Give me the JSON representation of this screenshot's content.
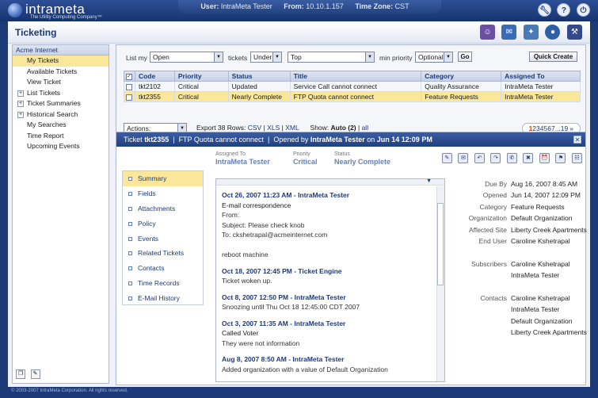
{
  "brand": {
    "name": "intrameta",
    "tagline": "The Utility Computing Company™"
  },
  "session": {
    "user_label": "User:",
    "user": "IntraMeta Tester",
    "from_label": "From:",
    "from": "10.10.1.157",
    "tz_label": "Time Zone:",
    "tz": "CST"
  },
  "top_icons": [
    "wrench-icon",
    "help-icon",
    "power-icon"
  ],
  "page_title": "Ticketing",
  "module_icons": [
    "users-icon",
    "ticket-icon",
    "network-icon",
    "globe-icon",
    "tools-icon"
  ],
  "sidebar": {
    "org": "Acme Internet",
    "items": [
      {
        "label": "My Tickets",
        "selected": true,
        "expandable": false
      },
      {
        "label": "Available Tickets",
        "selected": false,
        "expandable": false
      },
      {
        "label": "View Ticket",
        "selected": false,
        "expandable": false
      },
      {
        "label": "List Tickets",
        "selected": false,
        "expandable": true
      },
      {
        "label": "Ticket Summaries",
        "selected": false,
        "expandable": true
      },
      {
        "label": "Historical Search",
        "selected": false,
        "expandable": true
      },
      {
        "label": "My Searches",
        "selected": false,
        "expandable": false
      },
      {
        "label": "Time Report",
        "selected": false,
        "expandable": false
      },
      {
        "label": "Upcoming Events",
        "selected": false,
        "expandable": false
      }
    ]
  },
  "filters": {
    "list_my_label": "List my",
    "list_my_value": "Open",
    "tickets_label": "tickets",
    "under_value": "Under",
    "top_value": "Top",
    "min_priority_label": "min priority",
    "priority_value": "Optional",
    "go_label": "Go",
    "quick_create_label": "Quick Create"
  },
  "table": {
    "columns": [
      "Code",
      "Priority",
      "Status",
      "Title",
      "Category",
      "Assigned To"
    ],
    "rows": [
      {
        "code": "tkt2102",
        "priority": "Critical",
        "status": "Updated",
        "title": "Service Call cannot connect",
        "category": "Quality Assurance",
        "assigned": "IntraMeta Tester",
        "highlight": false
      },
      {
        "code": "tkt2355",
        "priority": "Critical",
        "status": "Nearly Complete",
        "title": "FTP Quota cannot connect",
        "category": "Feature Requests",
        "assigned": "IntraMeta Tester",
        "highlight": true
      }
    ]
  },
  "list_footer": {
    "actions_label": "Actions:",
    "export_label": "Export 38 Rows:",
    "csv": "CSV",
    "xls": "XLS",
    "xml": "XML",
    "show_label": "Show:",
    "auto": "Auto (2)",
    "all": "all",
    "pages": [
      "1",
      "2",
      "3",
      "4",
      "5",
      "6",
      "7",
      "...",
      "19"
    ],
    "current_page": "1",
    "next": "»"
  },
  "ticket": {
    "label": "Ticket",
    "code": "tkt2355",
    "title": "FTP Quota cannot connect",
    "opened_by_label": "Opened by",
    "opened_by": "IntraMeta Tester",
    "on_label": "on",
    "opened_at": "Jun 14 12:09 PM",
    "assigned_label": "Assigned To",
    "assigned": "IntraMeta Tester",
    "priority_label": "Priority",
    "priority": "Critical",
    "status_label": "Status",
    "status": "Nearly Complete"
  },
  "action_icons": [
    "note-icon",
    "email-icon",
    "reply-icon",
    "forward-icon",
    "mail-open-icon",
    "trash-icon",
    "alarm-icon",
    "tag-icon",
    "hierarchy-icon"
  ],
  "tabs": [
    {
      "label": "Summary",
      "selected": true
    },
    {
      "label": "Fields",
      "selected": false
    },
    {
      "label": "Attachments",
      "selected": false
    },
    {
      "label": "Policy",
      "selected": false
    },
    {
      "label": "Events",
      "selected": false
    },
    {
      "label": "Related Tickets",
      "selected": false
    },
    {
      "label": "Contacts",
      "selected": false
    },
    {
      "label": "Time Records",
      "selected": false
    },
    {
      "label": "E-Mail History",
      "selected": false
    }
  ],
  "history": [
    {
      "header": "Oct 26, 2007 11:23 AM - IntraMeta Tester",
      "title": "E-mail correspondence",
      "body": "From:\nSubject: Please check knob\nTo: ckshetrapal@acmeinternet.com\n\nreboot machine"
    },
    {
      "header": "Oct 18, 2007 12:45 PM - Ticket Engine",
      "title": "",
      "body": "Ticket woken up."
    },
    {
      "header": "Oct 8, 2007 12:50 PM - IntraMeta Tester",
      "title": "",
      "body": "Snoozing until Thu Oct 18 12:45:00 CDT 2007"
    },
    {
      "header": "Oct 3, 2007 11:35 AM - IntraMeta Tester",
      "title": "Called Voter",
      "body": "They were not information"
    },
    {
      "header": "Aug 8, 2007 8:50 AM - IntraMeta Tester",
      "title": "",
      "body": "Added organization with a value of Default Organization"
    }
  ],
  "fields": [
    {
      "k": "Due By",
      "v": "Aug 16, 2007 8:45 AM"
    },
    {
      "k": "Opened",
      "v": "Jun 14, 2007 12:09 PM"
    },
    {
      "k": "Category",
      "v": "Feature Requests"
    },
    {
      "k": "Organization",
      "v": "Default Organization"
    },
    {
      "k": "Affected Site",
      "v": "Liberty Creek Apartments"
    },
    {
      "k": "End User",
      "v": "Caroline Kshetrapal"
    },
    {
      "k": "",
      "v": ""
    },
    {
      "k": "Subscribers",
      "v": "Caroline Kshetrapal"
    },
    {
      "k": "",
      "v": "IntraMeta Tester"
    },
    {
      "k": "",
      "v": ""
    },
    {
      "k": "Contacts",
      "v": "Caroline Kshetrapal"
    },
    {
      "k": "",
      "v": "IntraMeta Tester"
    },
    {
      "k": "",
      "v": "Default Organization"
    },
    {
      "k": "",
      "v": "Liberty Creek Apartments"
    }
  ],
  "footer": "© 2003-2007 IntraMeta Corporation.  All rights reserved.",
  "colors": {
    "navy": "#1d3a78",
    "highlight": "#fbe79a"
  }
}
